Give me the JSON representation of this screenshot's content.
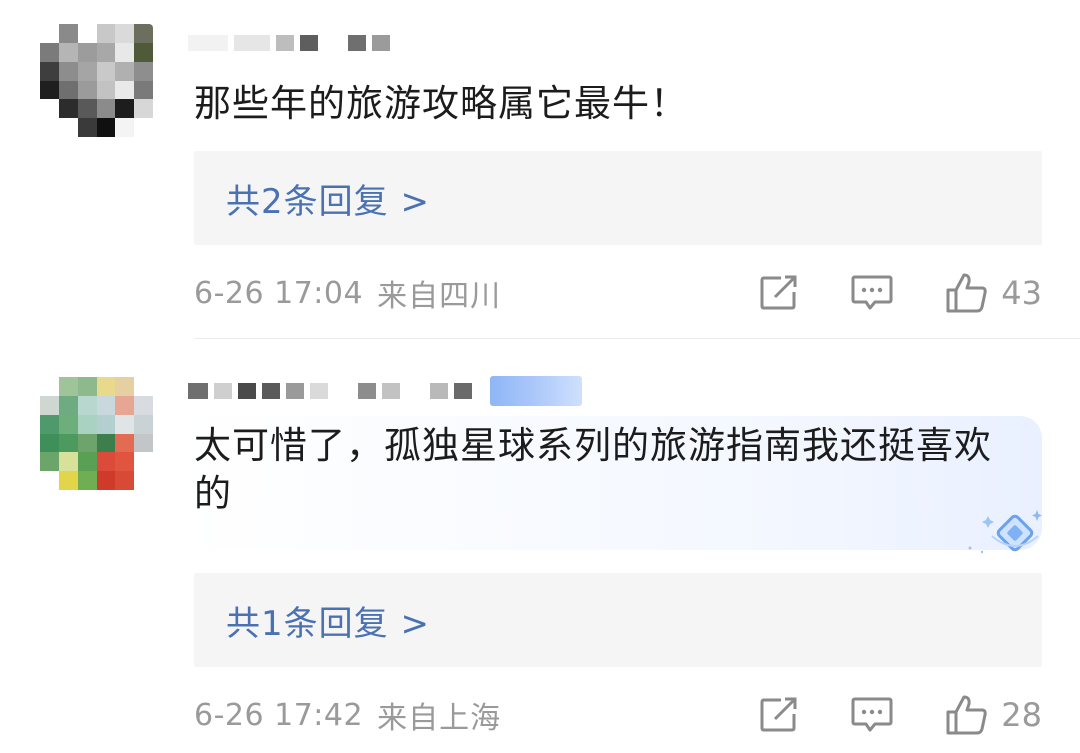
{
  "comments": [
    {
      "text": "那些年的旅游攻略属它最牛！",
      "replies_label": "共2条回复 >",
      "time": "6-26 17:04",
      "location": "来自四川",
      "likes": "43",
      "avatar_colors": [
        "#ffffff",
        "#8a8a8a",
        "#ffffff",
        "#c8c8c8",
        "#dadada",
        "#6c6f5d",
        "#7b7b7b",
        "#b5b5b5",
        "#9c9c9c",
        "#a8a8a8",
        "#e8e8e8",
        "#4f5a38",
        "#3e3e3e",
        "#8d8d8d",
        "#a5a5a5",
        "#c9c9c9",
        "#b0b0b0",
        "#8e8e8e",
        "#1f1f1f",
        "#6f6f6f",
        "#9b9b9b",
        "#c2c2c2",
        "#e9e9e9",
        "#7a7a7a",
        "#ffffff",
        "#2c2c2c",
        "#595959",
        "#8b8b8b",
        "#1d1d1d",
        "#d7d7d7",
        "#ffffff",
        "#ffffff",
        "#3a3a3a",
        "#101010",
        "#f4f4f4",
        "#ffffff"
      ]
    },
    {
      "text": "太可惜了，孤独星球系列的旅游指南我还挺喜欢的",
      "replies_label": "共1条回复 >",
      "time": "6-26 17:42",
      "location": "来自上海",
      "likes": "28",
      "avatar_colors": [
        "#ffffff",
        "#9fc49a",
        "#8db98c",
        "#e8d98c",
        "#e6cfa0",
        "#ffffff",
        "#cfd8d0",
        "#6fab80",
        "#b8d7cf",
        "#c8d8dc",
        "#e7a694",
        "#d8dbe0",
        "#4f9a6d",
        "#6caf7a",
        "#a9d2c2",
        "#b3cfd0",
        "#dfe5e6",
        "#c9d3d6",
        "#3f8f5b",
        "#4c9a5f",
        "#6ea36b",
        "#3d7f4c",
        "#e36b53",
        "#c2c6c8",
        "#6ba56a",
        "#d7e19a",
        "#59a055",
        "#dc4b3a",
        "#e0553f",
        "#ffffff",
        "#ffffff",
        "#e2d54a",
        "#6fae52",
        "#cf3a2a",
        "#d94a36",
        "#ffffff"
      ]
    }
  ],
  "icons": [
    "share-icon",
    "comment-icon",
    "like-icon"
  ],
  "colors": {
    "reply_link": "#4a72b3",
    "meta_text": "#9a9a9a",
    "reply_box_bg": "#f5f5f5"
  }
}
